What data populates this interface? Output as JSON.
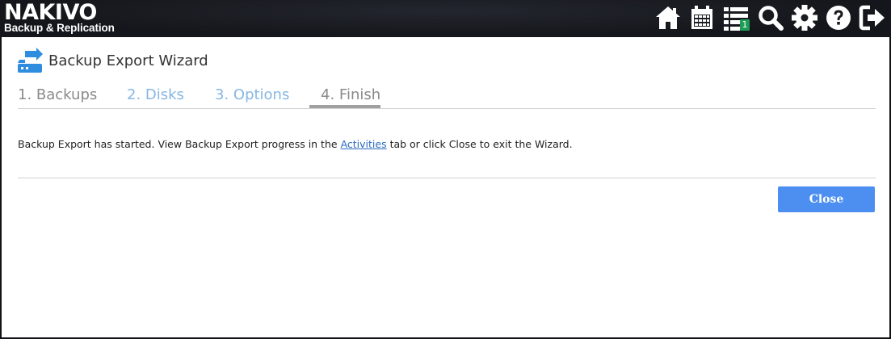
{
  "app": {
    "brand_name": "NAKIVO",
    "brand_subtitle": "Backup & Replication"
  },
  "toolbar": {
    "icons": [
      {
        "name": "home-icon"
      },
      {
        "name": "calendar-icon"
      },
      {
        "name": "activities-list-icon",
        "badge": "1"
      },
      {
        "name": "search-icon"
      },
      {
        "name": "gear-icon"
      },
      {
        "name": "help-icon"
      },
      {
        "name": "logout-icon"
      }
    ],
    "badge_color": "#1e9b57"
  },
  "wizard": {
    "title": "Backup Export Wizard",
    "icon": "backup-export-icon",
    "steps": [
      {
        "label": "1. Backups",
        "state": "done"
      },
      {
        "label": "2. Disks",
        "state": "link"
      },
      {
        "label": "3. Options",
        "state": "link"
      },
      {
        "label": "4. Finish",
        "state": "active"
      }
    ],
    "message": {
      "before": "Backup Export has started. View Backup Export progress in the ",
      "link": "Activities",
      "after": " tab or click Close to exit the Wizard."
    },
    "close_label": "Close"
  },
  "colors": {
    "accent": "#4d8ff0",
    "link": "#2a6bc2",
    "step_link": "#86b7e4",
    "icon_blue": "#2f8de0"
  }
}
